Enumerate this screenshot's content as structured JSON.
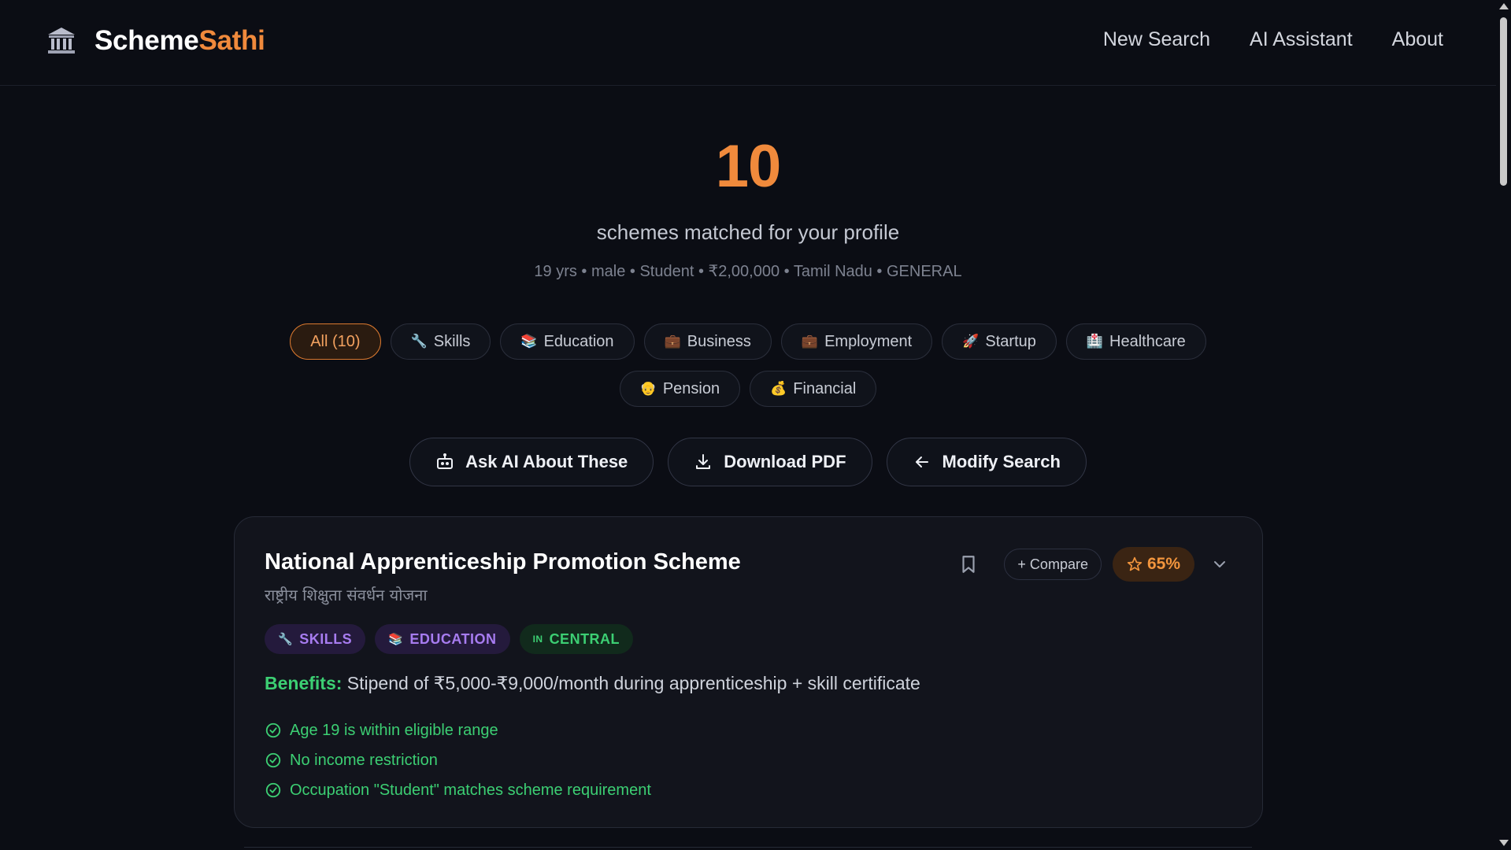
{
  "header": {
    "brand_part1": "Scheme",
    "brand_part2": "Sathi",
    "nav": [
      "New Search",
      "AI Assistant",
      "About"
    ]
  },
  "hero": {
    "count": "10",
    "subtitle": "schemes matched for your profile",
    "profile": "19 yrs • male • Student • ₹2,00,000 • Tamil Nadu • GENERAL"
  },
  "filters": [
    {
      "emoji": "",
      "label": "All (10)",
      "active": true
    },
    {
      "emoji": "🔧",
      "label": "Skills"
    },
    {
      "emoji": "📚",
      "label": "Education"
    },
    {
      "emoji": "💼",
      "label": "Business"
    },
    {
      "emoji": "💼",
      "label": "Employment"
    },
    {
      "emoji": "🚀",
      "label": "Startup"
    },
    {
      "emoji": "🏥",
      "label": "Healthcare"
    },
    {
      "emoji": "👴",
      "label": "Pension"
    },
    {
      "emoji": "💰",
      "label": "Financial"
    }
  ],
  "actions": {
    "ask_ai": "Ask AI About These",
    "download_pdf": "Download PDF",
    "modify_search": "Modify Search"
  },
  "scheme": {
    "title": "National Apprenticeship Promotion Scheme",
    "title_hindi": "राष्ट्रीय शिक्षुता संवर्धन योजना",
    "compare_label": "+ Compare",
    "score": "65%",
    "tags": [
      {
        "emoji": "🔧",
        "label": "SKILLS"
      },
      {
        "emoji": "📚",
        "label": "EDUCATION"
      },
      {
        "emoji": "IN",
        "label": "CENTRAL"
      }
    ],
    "benefits_label": "Benefits:",
    "benefits_text": "Stipend of ₹5,000-₹9,000/month during apprenticeship + skill certificate",
    "checks": [
      "Age 19 is within eligible range",
      "No income restriction",
      "Occupation \"Student\" matches scheme requirement"
    ]
  },
  "colors": {
    "accent": "#f08a3c",
    "success": "#3ccf73",
    "tag_purple": "#a77cf0",
    "background": "#0b0d14"
  }
}
